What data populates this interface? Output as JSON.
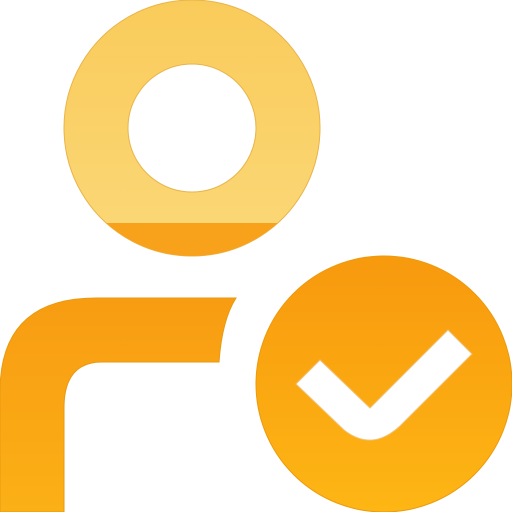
{
  "icon": {
    "name": "user-verified-icon",
    "parts": [
      "user-head-icon",
      "user-shoulder-icon",
      "check-badge-icon",
      "checkmark-icon"
    ],
    "colors": {
      "head_light": "#FBD878",
      "head_mid": "#F9CB5A",
      "head_band": "#F8A21B",
      "body_top": "#F89C12",
      "body_bottom": "#FBB016",
      "badge_top": "#F8990E",
      "badge_bottom": "#FDB614",
      "check": "#ffffff",
      "background": "#ffffff"
    }
  }
}
